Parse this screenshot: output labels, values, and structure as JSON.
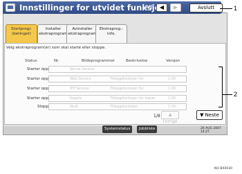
{
  "titlebar": {
    "title": "Innstillinger for utvidet funksjon",
    "page_indicator": "2/2",
    "prev_glyph": "◀",
    "next_glyph": "▶",
    "exit_label": "Avslutt"
  },
  "tabs": [
    {
      "label": "Startprogr.\n(betinget)",
      "active": true
    },
    {
      "label": "Installer\nekstraprogram",
      "active": false
    },
    {
      "label": "Avinstaller\nekstraprogram",
      "active": false
    },
    {
      "label": "Ekstraprog.-\ninfo.",
      "active": false
    }
  ],
  "instruction": "Velg ekstraprogram(er) som skal starte eller stoppe.",
  "table": {
    "headers": [
      "Status",
      "Nr.",
      "Bildeprogrammer",
      "Beskrivelse",
      "Versjon"
    ],
    "rows": [
      {
        "status": "Starter opp",
        "nr": "",
        "program": "Skrive Service",
        "description": "",
        "version": ""
      },
      {
        "status": "Starter opp",
        "nr": "",
        "program": "Web Service",
        "description": "Tilleggsfunksjon for",
        "version": "1.00"
      },
      {
        "status": "Starter opp",
        "nr": "",
        "program": "IPP Service",
        "description": "Tilleggsfunksjon for",
        "version": "1.00"
      },
      {
        "status": "Starter opp",
        "nr": "",
        "program": "Koppie",
        "description": "Tilleggsfunksjon for kopier",
        "version": "1.00"
      },
      {
        "status": "Stopp",
        "nr": "",
        "program": "Multi",
        "description": "Tilleggsfunksjon",
        "version": "1.00"
      }
    ]
  },
  "pager": {
    "counter": "1/8",
    "up_label": "▲ Forrige",
    "next_label": "▼ Neste"
  },
  "statusbar": {
    "system_status": "Systemstatus",
    "job_list": "Jobbliste",
    "date": "26 AUG 2007",
    "time": "14:27"
  },
  "callouts": [
    "1",
    "2"
  ],
  "figure_code": "NO BX0030"
}
